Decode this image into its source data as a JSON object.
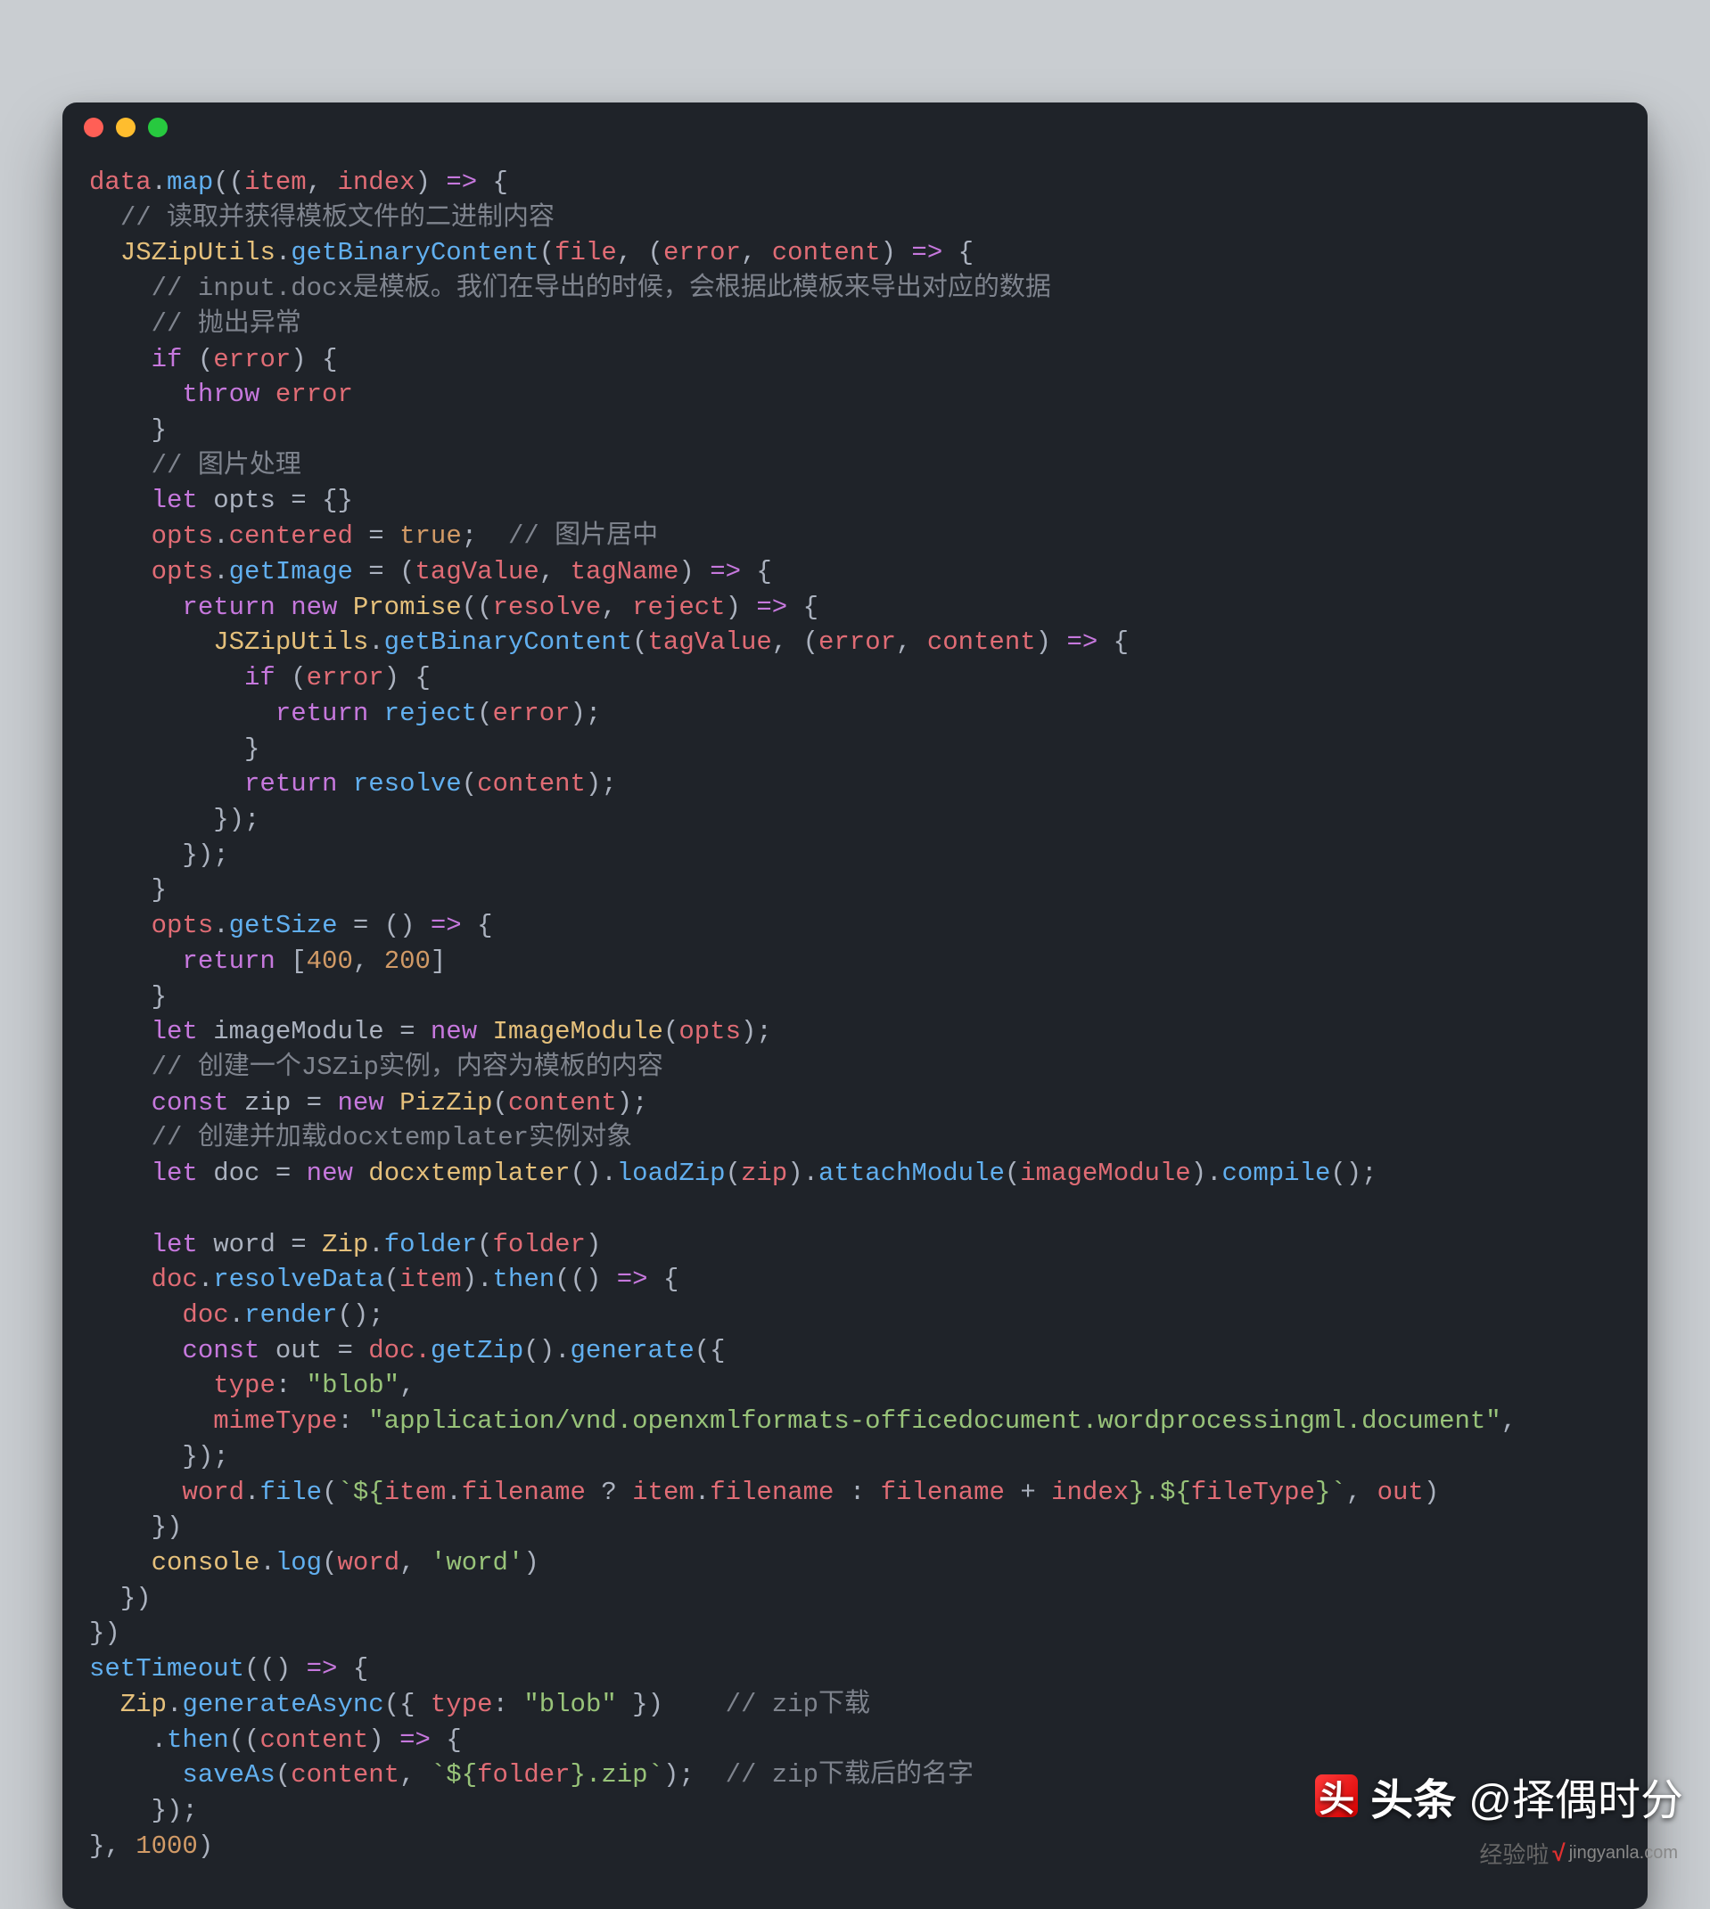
{
  "colors": {
    "background": "#c9cdd1",
    "editor_bg": "#1f2329",
    "red": "#ff5f56",
    "yellow": "#ffbd2e",
    "green": "#27c93f",
    "text": "#abb2bf",
    "keyword": "#c678dd",
    "function": "#61afef",
    "variable": "#e06c75",
    "string": "#98c379",
    "number": "#d19a66",
    "comment": "#7f848e",
    "constant": "#e5c07b"
  },
  "code": {
    "line01": {
      "a": "data",
      "b": ".",
      "c": "map",
      "d": "((",
      "e": "item",
      "f": ", ",
      "g": "index",
      "h": ") ",
      "i": "=>",
      "j": " {"
    },
    "line02": {
      "a": "// 读取并获得模板文件的二进制内容"
    },
    "line03": {
      "a": "JSZipUtils",
      "b": ".",
      "c": "getBinaryContent",
      "d": "(",
      "e": "file",
      "f": ", (",
      "g": "error",
      "h": ", ",
      "i": "content",
      "j": ") ",
      "k": "=>",
      "l": " {"
    },
    "line04": {
      "a": "// input.docx是模板。我们在导出的时候，会根据此模板来导出对应的数据"
    },
    "line05": {
      "a": "// 抛出异常"
    },
    "line06": {
      "a": "if",
      "b": " (",
      "c": "error",
      "d": ") {"
    },
    "line07": {
      "a": "throw",
      "b": " error"
    },
    "line08": {
      "a": "}"
    },
    "line09": {
      "a": "// 图片处理"
    },
    "line10": {
      "a": "let",
      "b": " opts ",
      "c": "=",
      "d": " {}"
    },
    "line11": {
      "a": "opts",
      "b": ".",
      "c": "centered",
      "d": " = ",
      "e": "true",
      "f": ";  ",
      "g": "// 图片居中"
    },
    "line12": {
      "a": "opts",
      "b": ".",
      "c": "getImage",
      "d": " = (",
      "e": "tagValue",
      "f": ", ",
      "g": "tagName",
      "h": ") ",
      "i": "=>",
      "j": " {"
    },
    "line13": {
      "a": "return",
      "b": " ",
      "c": "new",
      "d": " ",
      "e": "Promise",
      "f": "((",
      "g": "resolve",
      "h": ", ",
      "i": "reject",
      "j": ") ",
      "k": "=>",
      "l": " {"
    },
    "line14": {
      "a": "JSZipUtils",
      "b": ".",
      "c": "getBinaryContent",
      "d": "(",
      "e": "tagValue",
      "f": ", (",
      "g": "error",
      "h": ", ",
      "i": "content",
      "j": ") ",
      "k": "=>",
      "l": " {"
    },
    "line15": {
      "a": "if",
      "b": " (",
      "c": "error",
      "d": ") {"
    },
    "line16": {
      "a": "return",
      "b": " ",
      "c": "reject",
      "d": "(",
      "e": "error",
      "f": ");"
    },
    "line17": {
      "a": "}"
    },
    "line18": {
      "a": "return",
      "b": " ",
      "c": "resolve",
      "d": "(",
      "e": "content",
      "f": ");"
    },
    "line19": {
      "a": "});"
    },
    "line20": {
      "a": "});"
    },
    "line21": {
      "a": "}"
    },
    "line22": {
      "a": "opts",
      "b": ".",
      "c": "getSize",
      "d": " = () ",
      "e": "=>",
      "f": " {"
    },
    "line23": {
      "a": "return",
      "b": " [",
      "c": "400",
      "d": ", ",
      "e": "200",
      "f": "]"
    },
    "line24": {
      "a": "}"
    },
    "line25": {
      "a": "let",
      "b": " imageModule ",
      "c": "=",
      "d": " ",
      "e": "new",
      "f": " ",
      "g": "ImageModule",
      "h": "(",
      "i": "opts",
      "j": ");"
    },
    "line26": {
      "a": "// 创建一个JSZip实例，内容为模板的内容"
    },
    "line27": {
      "a": "const",
      "b": " zip ",
      "c": "=",
      "d": " ",
      "e": "new",
      "f": " ",
      "g": "PizZip",
      "h": "(",
      "i": "content",
      "j": ");"
    },
    "line28": {
      "a": "// 创建并加载docxtemplater实例对象"
    },
    "line29": {
      "a": "let",
      "b": " doc ",
      "c": "=",
      "d": " ",
      "e": "new",
      "f": " ",
      "g": "docxtemplater",
      "h": "().",
      "i": "loadZip",
      "j": "(",
      "k": "zip",
      "l": ").",
      "m": "attachModule",
      "n": "(",
      "o": "imageModule",
      "p": ").",
      "q": "compile",
      "r": "();"
    },
    "line30": "",
    "line31": {
      "a": "let",
      "b": " word ",
      "c": "=",
      "d": " ",
      "e": "Zip",
      "f": ".",
      "g": "folder",
      "h": "(",
      "i": "folder",
      "j": ")"
    },
    "line32": {
      "a": "doc",
      "b": ".",
      "c": "resolveData",
      "d": "(",
      "e": "item",
      "f": ").",
      "g": "then",
      "h": "(() ",
      "i": "=>",
      "j": " {"
    },
    "line33": {
      "a": "doc",
      "b": ".",
      "c": "render",
      "d": "();"
    },
    "line34": {
      "a": "const",
      "b": " out ",
      "c": "=",
      "d": " doc.",
      "e": "getZip",
      "f": "().",
      "g": "generate",
      "h": "({"
    },
    "line35": {
      "a": "type",
      "b": ": ",
      "c": "\"blob\"",
      "d": ","
    },
    "line36": {
      "a": "mimeType",
      "b": ": ",
      "c": "\"application/vnd.openxmlformats-officedocument.wordprocessingml.document\"",
      "d": ","
    },
    "line37": {
      "a": "});"
    },
    "line38": {
      "a": "word",
      "b": ".",
      "c": "file",
      "d": "(",
      "e": "`${",
      "f": "item",
      "g": ".",
      "h": "filename",
      "i": " ? ",
      "j": "item",
      "k": ".",
      "l": "filename",
      "m": " : ",
      "n": "filename ",
      "o": "+",
      "p": " index",
      "q": "}.${",
      "r": "fileType",
      "s": "}`",
      "t": ", ",
      "u": "out",
      "v": ")"
    },
    "line39": {
      "a": "})"
    },
    "line40": {
      "a": "console",
      "b": ".",
      "c": "log",
      "d": "(",
      "e": "word",
      "f": ", ",
      "g": "'word'",
      "h": ")"
    },
    "line41": {
      "a": "})"
    },
    "line42": {
      "a": "})"
    },
    "line43": {
      "a": "setTimeout",
      "b": "(() ",
      "c": "=>",
      "d": " {"
    },
    "line44": {
      "a": "Zip",
      "b": ".",
      "c": "generateAsync",
      "d": "({ ",
      "e": "type",
      "f": ": ",
      "g": "\"blob\"",
      "h": " })    ",
      "i": "// zip下载"
    },
    "line45": {
      "a": ".",
      "b": "then",
      "c": "((",
      "d": "content",
      "e": ") ",
      "f": "=>",
      "g": " {"
    },
    "line46": {
      "a": "saveAs",
      "b": "(",
      "c": "content",
      "d": ", ",
      "e": "`${",
      "f": "folder",
      "g": "}.zip`",
      "h": ");  ",
      "i": "// zip下载后的名字"
    },
    "line47": {
      "a": "});"
    },
    "line48": {
      "a": "}, ",
      "b": "1000",
      "c": ")"
    }
  },
  "watermark": {
    "top_left": "头条",
    "top_right": "@择偶时分",
    "bottom_brand": "经验啦",
    "bottom_check": "√",
    "bottom_domain": "jingyanla.com"
  }
}
